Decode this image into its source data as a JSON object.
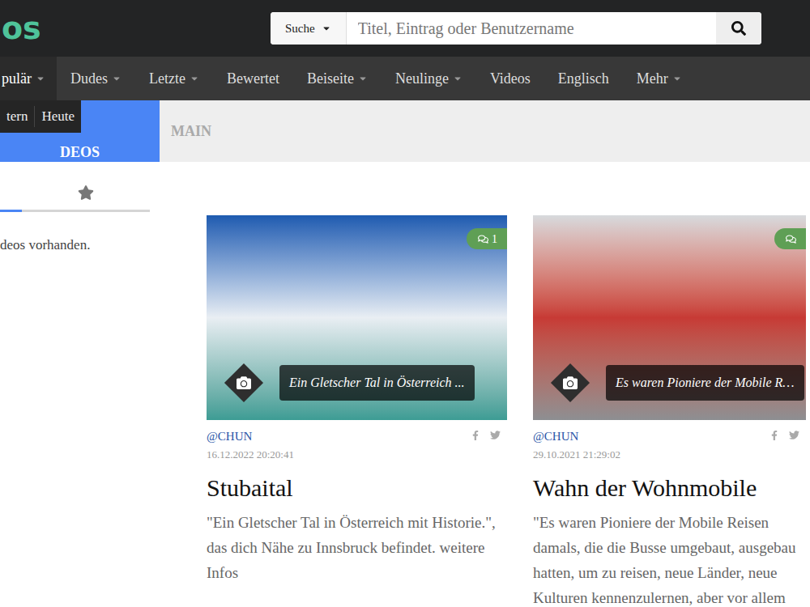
{
  "logo": "os",
  "search": {
    "scope": "Suche",
    "placeholder": "Titel, Eintrag oder Benutzername"
  },
  "nav": [
    {
      "label": "pulär",
      "dropdown": true,
      "selected": true
    },
    {
      "label": "Dudes",
      "dropdown": true,
      "selected": false
    },
    {
      "label": "Letzte",
      "dropdown": true,
      "selected": false
    },
    {
      "label": "Bewertet",
      "dropdown": false,
      "selected": false
    },
    {
      "label": "Beiseite",
      "dropdown": true,
      "selected": false
    },
    {
      "label": "Neulinge",
      "dropdown": true,
      "selected": false
    },
    {
      "label": "Videos",
      "dropdown": false,
      "selected": false
    },
    {
      "label": "Englisch",
      "dropdown": false,
      "selected": false
    },
    {
      "label": "Mehr",
      "dropdown": true,
      "selected": false
    }
  ],
  "submenu": [
    {
      "label": "tern"
    },
    {
      "label": "Heute"
    }
  ],
  "section": {
    "left": "DEOS",
    "right": "MAIN"
  },
  "sidebar": {
    "tabs": [
      {
        "selected": true
      },
      {
        "selected": false
      }
    ],
    "message": "deos vorhanden."
  },
  "cards": [
    {
      "comments": "1",
      "caption": "Ein Gletscher Tal in Österreich ...",
      "author": "@CHUN",
      "date": "16.12.2022 20:20:41",
      "title": "Stubaital",
      "description": "\"Ein Gletscher Tal in Österreich mit Historie.\", das dich Nähe zu Innsbruck befindet. weitere Infos",
      "image": "mountain"
    },
    {
      "comments": null,
      "caption": "Es waren Pioniere der Mobile R…",
      "author": "@CHUN",
      "date": "29.10.2021 21:29:02",
      "title": "Wahn der Wohnmobile",
      "description": "\"Es waren Pioniere der Mobile Reisen damals, die die Busse umgebaut, ausgebau hatten, um zu reisen, neue Länder, neue Kulturen kennenzulernen, aber vor allem",
      "image": "van"
    }
  ]
}
